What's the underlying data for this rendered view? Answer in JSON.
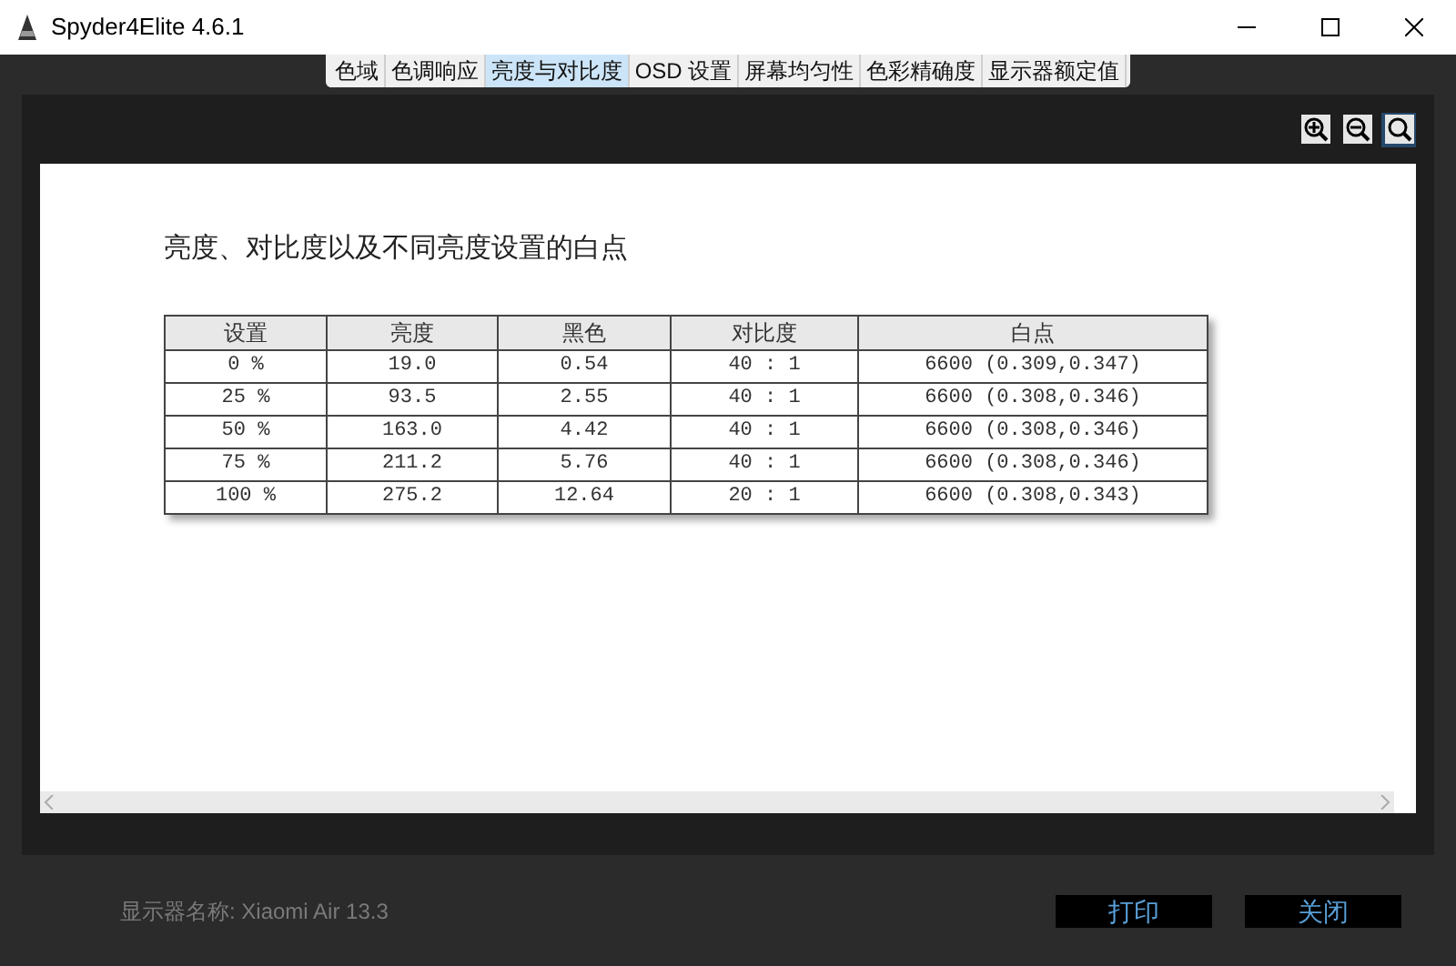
{
  "window": {
    "title": "Spyder4Elite 4.6.1"
  },
  "tabs": [
    {
      "label": "色域",
      "selected": false
    },
    {
      "label": "色调响应",
      "selected": false
    },
    {
      "label": "亮度与对比度",
      "selected": true
    },
    {
      "label": "OSD 设置",
      "selected": false
    },
    {
      "label": "屏幕均匀性",
      "selected": false
    },
    {
      "label": "色彩精确度",
      "selected": false
    },
    {
      "label": "显示器额定值",
      "selected": false
    }
  ],
  "zoom_tools": [
    {
      "kind": "zoom-in",
      "selected": false
    },
    {
      "kind": "zoom-out",
      "selected": false
    },
    {
      "kind": "zoom-fit",
      "selected": true
    }
  ],
  "report": {
    "heading": "亮度、对比度以及不同亮度设置的白点",
    "table": {
      "columns": [
        "设置",
        "亮度",
        "黑色",
        "对比度",
        "白点"
      ],
      "rows": [
        [
          "0 %",
          "19.0",
          "0.54",
          "40 : 1",
          "6600 (0.309,0.347)"
        ],
        [
          "25 %",
          "93.5",
          "2.55",
          "40 : 1",
          "6600 (0.308,0.346)"
        ],
        [
          "50 %",
          "163.0",
          "4.42",
          "40 : 1",
          "6600 (0.308,0.346)"
        ],
        [
          "75 %",
          "211.2",
          "5.76",
          "40 : 1",
          "6600 (0.308,0.346)"
        ],
        [
          "100 %",
          "275.2",
          "12.64",
          "20 : 1",
          "6600 (0.308,0.343)"
        ]
      ]
    }
  },
  "footer": {
    "display_name": "显示器名称: Xiaomi Air 13.3",
    "buttons": [
      "打印",
      "关闭"
    ]
  }
}
